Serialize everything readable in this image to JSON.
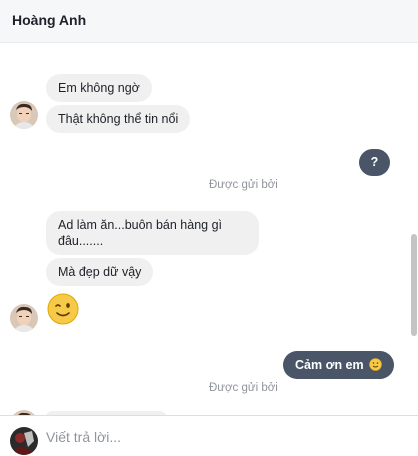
{
  "header": {
    "title": "Hoàng Anh"
  },
  "messages": [
    {
      "text": "Em không ngờ",
      "direction": "in"
    },
    {
      "text": "Thật không thể tin nổi",
      "direction": "in"
    },
    {
      "text": "?",
      "direction": "out"
    },
    {
      "text": "Ad làm ăn...buôn bán hàng gì đâu.......",
      "direction": "in"
    },
    {
      "text": "Mà đẹp dữ vậy",
      "direction": "in"
    },
    {
      "emoji": "wink-emoji",
      "direction": "in"
    },
    {
      "text": "Cảm ơn em",
      "emoji": "smile-emoji",
      "direction": "out"
    }
  ],
  "status": {
    "sent_by_1": "Được gửi bởi ",
    "sent_by_2": "Được gửi bởi "
  },
  "composer": {
    "placeholder": "Viết trả lời..."
  },
  "colors": {
    "incoming_bubble": "#f1f0f0",
    "outgoing_bubble": "#4a5568",
    "header_bg": "#f6f7f9"
  }
}
